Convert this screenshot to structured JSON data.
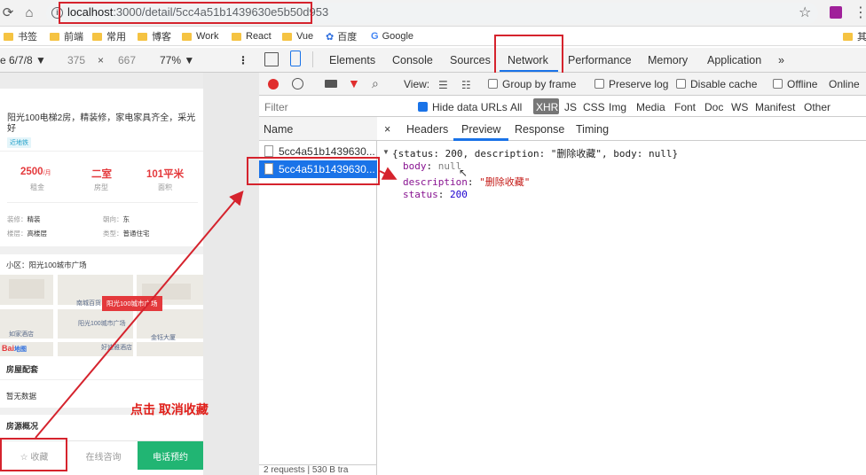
{
  "browser": {
    "url_host": "localhost",
    "url_rest": ":3000/detail/5cc4a51b1439630e5b50d953",
    "bookmarks": [
      "书签",
      "前端",
      "常用",
      "博客",
      "Work",
      "React",
      "Vue",
      "百度",
      "Google",
      "其"
    ]
  },
  "device_toolbar": {
    "device": "e 6/7/8 ▼",
    "width": "375",
    "times": "×",
    "height": "667",
    "zoom": "77% ▼"
  },
  "mobile_page": {
    "title": "阳光100电梯2房，精装修，家电家具齐全，采光好",
    "tag": "近地铁",
    "stats": [
      {
        "value": "2500",
        "unit": "/月",
        "label": "租金"
      },
      {
        "value": "二室",
        "unit": "",
        "label": "房型"
      },
      {
        "value": "101平米",
        "unit": "",
        "label": "面积"
      }
    ],
    "info": [
      {
        "k": "装修：",
        "v": "精装"
      },
      {
        "k": "朝向：",
        "v": "东"
      },
      {
        "k": "楼层：",
        "v": "高楼层"
      },
      {
        "k": "类型：",
        "v": "普通住宅"
      }
    ],
    "community": "小区：阳光100城市广场",
    "map_marker": "阳光100城市广场",
    "map_labels": [
      "南城百货",
      "阳光100城市广场",
      "如家酒店",
      "好迪雅酒店",
      "金钰大厦"
    ],
    "map_logo": "Bai",
    "map_logo_suffix": "地图",
    "section_facilities": "房屋配套",
    "no_data": "暂无数据",
    "section_overview": "房源概况",
    "bottom_fav": "☆ 收藏",
    "bottom_consult": "在线咨询",
    "bottom_call": "电话预约"
  },
  "annotation": "点击 取消收藏",
  "devtools": {
    "tabs": [
      "Elements",
      "Console",
      "Sources",
      "Network",
      "Performance",
      "Memory",
      "Application",
      "»"
    ],
    "active_tab": "Network",
    "view_label": "View:",
    "group_by_frame": "Group by frame",
    "preserve_log": "Preserve log",
    "disable_cache": "Disable cache",
    "offline": "Offline",
    "online": "Online",
    "filter_placeholder": "Filter",
    "hide_data_urls": "Hide data URLs",
    "types": [
      "All",
      "XHR",
      "JS",
      "CSS",
      "Img",
      "Media",
      "Font",
      "Doc",
      "WS",
      "Manifest",
      "Other"
    ],
    "active_type": "XHR",
    "name_header": "Name",
    "requests": [
      "5cc4a51b1439630...",
      "5cc4a51b1439630..."
    ],
    "detail_tabs": [
      "×",
      "Headers",
      "Preview",
      "Response",
      "Timing"
    ],
    "active_detail": "Preview",
    "preview_summary": "{status: 200, description: \"删除收藏\", body: null}",
    "preview_lines": [
      {
        "key": "body",
        "value": "null"
      },
      {
        "key": "description",
        "value": "\"删除收藏\""
      },
      {
        "key": "status",
        "value": "200"
      }
    ],
    "status_bar": "2 requests | 530 B tra"
  },
  "colors": {
    "accent_red": "#d5232d",
    "price_red": "#e4393c",
    "call_green": "#21b573",
    "devtools_blue": "#1a73e8"
  }
}
